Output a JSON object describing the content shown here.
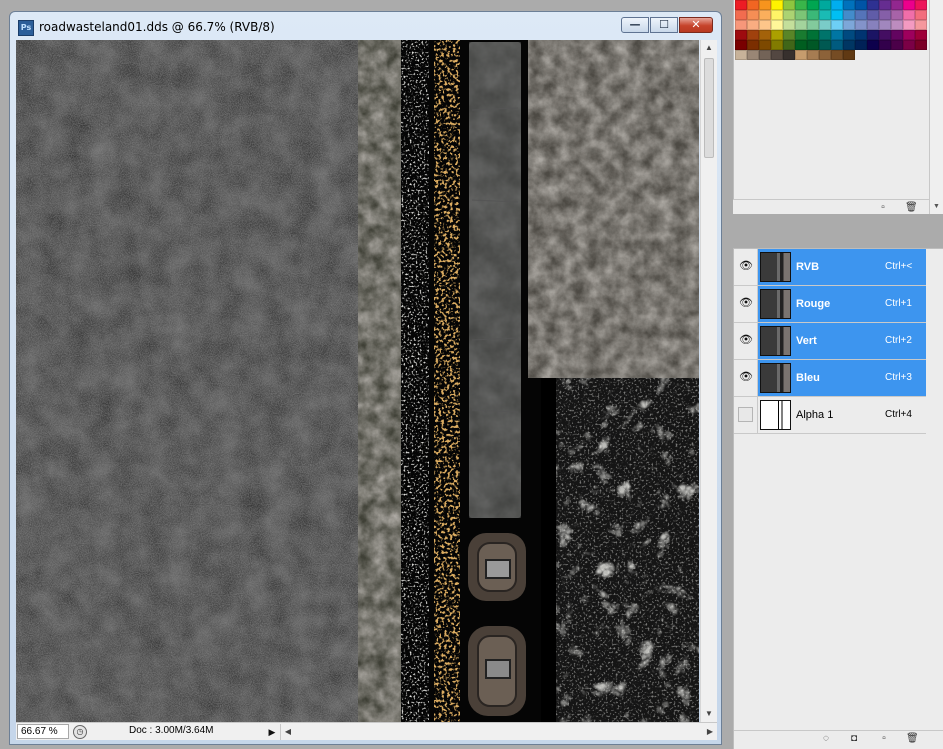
{
  "document": {
    "title": "roadwasteland01.dds @ 66.7% (RVB/8)",
    "app_icon": "photoshop-icon",
    "zoom": "66.67 %",
    "doc_info": "Doc : 3.00M/3.64M"
  },
  "window_buttons": {
    "minimize": "—",
    "maximize": "☐",
    "close": "✕"
  },
  "swatches": {
    "colors": [
      "#ed1c24",
      "#f26522",
      "#f7941d",
      "#fff200",
      "#8dc63f",
      "#39b54a",
      "#00a651",
      "#00a99d",
      "#00aeef",
      "#0072bc",
      "#0054a6",
      "#2e3192",
      "#662d91",
      "#92278f",
      "#ec008c",
      "#ed145b",
      "#f26c4f",
      "#f68e55",
      "#fbaf5c",
      "#fff467",
      "#acd372",
      "#7cc576",
      "#3bb878",
      "#1abbb4",
      "#00bff3",
      "#438ccb",
      "#5574b9",
      "#605ca8",
      "#855fa8",
      "#a763a8",
      "#f06ea9",
      "#f26d7d",
      "#f7977a",
      "#f9ad81",
      "#fdc68a",
      "#fff799",
      "#c4df9b",
      "#a3d39c",
      "#82ca9c",
      "#7accc8",
      "#6dcff6",
      "#7da7d9",
      "#8393ca",
      "#8781bd",
      "#a187be",
      "#bd8cbf",
      "#f49ac1",
      "#f5989d",
      "#9e0b0f",
      "#a0410d",
      "#a3620a",
      "#aba000",
      "#598527",
      "#197b30",
      "#007236",
      "#00746b",
      "#0076a3",
      "#004a80",
      "#003471",
      "#1b1464",
      "#440e62",
      "#630460",
      "#9e005d",
      "#9e0039",
      "#790000",
      "#7b2e00",
      "#7d4900",
      "#827b00",
      "#406618",
      "#005e20",
      "#005826",
      "#005952",
      "#005b7f",
      "#003663",
      "#002157",
      "#0d004c",
      "#32004b",
      "#4b0049",
      "#7b0046",
      "#7a0026",
      "#c7b299",
      "#998675",
      "#736357",
      "#534741",
      "#37302d",
      "#c69c6d",
      "#a67c52",
      "#8c6239",
      "#754c24",
      "#603913"
    ]
  },
  "channels": {
    "rows": [
      {
        "name": "RVB",
        "shortcut": "Ctrl+<",
        "visible": true,
        "selected": true
      },
      {
        "name": "Rouge",
        "shortcut": "Ctrl+1",
        "visible": true,
        "selected": true
      },
      {
        "name": "Vert",
        "shortcut": "Ctrl+2",
        "visible": true,
        "selected": true
      },
      {
        "name": "Bleu",
        "shortcut": "Ctrl+3",
        "visible": true,
        "selected": true
      },
      {
        "name": "Alpha 1",
        "shortcut": "Ctrl+4",
        "visible": false,
        "selected": false
      }
    ]
  },
  "icons": {
    "eye": "eye-icon",
    "new": "new-item-icon",
    "trash": "trash-icon",
    "selection": "load-selection-icon",
    "mask": "save-selection-icon",
    "status": "status-menu-icon"
  }
}
